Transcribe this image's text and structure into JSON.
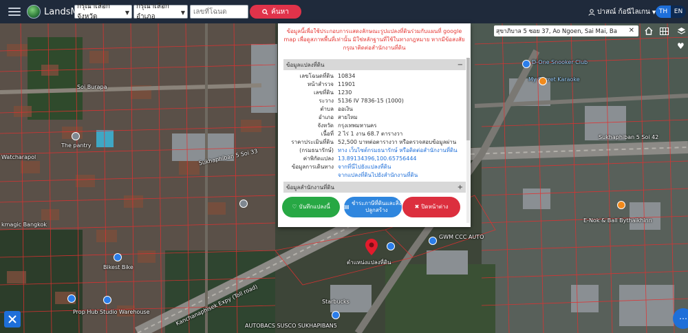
{
  "topbar": {
    "brand": "LandsMaps",
    "province_select": "กรุณาเลือกจังหวัด",
    "district_select": "กรุณาเลือกอำเภอ",
    "plot_placeholder": "เลขที่โฉนด",
    "search_label": "ค้นหา",
    "user_name": "ปาสณ์ ก้อนีไลเกน",
    "lang_th": "TH",
    "lang_en": "EN",
    "colors": {
      "bar": "#1f2a3b",
      "search_button": "#e0334a",
      "lang_active": "#1e6fd9"
    }
  },
  "map": {
    "search_value": "สุขาภิบาล 5 ซอย 37, Ao Ngoen, Sai Mai, Ba",
    "labels": {
      "soi_burapa": "Soi Burapa",
      "the_pantry": "The pantry",
      "watcharapol": "Watcharapol",
      "sukhaphiban5_soi33": "Sukhaphiban 5 Soi 33",
      "kmagic": "kmagic Bangkok",
      "prop_hub": "Prop Hub Studio Warehouse",
      "sukhaphiban5_soi42": "Sukhaphiban 5 Soi 42",
      "d_one": "D-One Snooker Club",
      "myscent": "My Secret Karaoke",
      "gwm": "GWM CCC AUTO",
      "e_nok": "E-Nok & Ball Bythaikhinn",
      "starbucks": "Starbucks",
      "autobacs": "AUTOBACS SUSCO SUKHAPIBAN5",
      "bikest": "Bikest Bike",
      "expy": "Kanchanaphisek Expy (Toll road)",
      "site": "ตำแหน่งแปลงที่ดิน"
    }
  },
  "popup": {
    "notice": "ข้อมูลนี้เพื่อใช้ประกอบการแสดงลักษณะรูปแปลงที่ดินร่วมกับแผนที่ google map เพื่อดูสภาพพื้นที่เท่านั้น มิใช่หลักฐานที่ใช้ในทางกฎหมาย หากมีข้อสงสัย กรุณาติดต่อสำนักงานที่ดิน",
    "section_parcel": "ข้อมูลแปลงที่ดิน",
    "section_office": "ข้อมูลสำนักงานที่ดิน",
    "rows": [
      {
        "k": "เลขโฉนดที่ดิน",
        "v": "10834"
      },
      {
        "k": "หน้าสำรวจ",
        "v": "11901"
      },
      {
        "k": "เลขที่ดิน",
        "v": "1230"
      },
      {
        "k": "ระวาง",
        "v": "5136 IV 7836-15 (1000)"
      },
      {
        "k": "ตำบล",
        "v": "ออเงิน"
      },
      {
        "k": "อำเภอ",
        "v": "สายไหม"
      },
      {
        "k": "จังหวัด",
        "v": "กรุงเทพมหานคร"
      },
      {
        "k": "เนื้อที่",
        "v": "2 ไร่ 1 งาน 68.7 ตารางวา"
      },
      {
        "k": "ราคาประเมินที่ดิน",
        "v": "52,500 บาทต่อตารางวา หรือตรวจสอบข้อมูลผ่าน"
      },
      {
        "k": "(กรมธนารักษ์)",
        "v": "ทาง เว็บไซต์กรมธนารักษ์ หรือติดต่อสำนักงานที่ดิน"
      },
      {
        "k": "ค่าพิกัดแปลง",
        "v": "13.89134396,100.65756444"
      },
      {
        "k": "ข้อมูลการเดินทาง",
        "v": "จากที่นี่ไปยังแปลงที่ดิน"
      },
      {
        "k": "",
        "v": "จากแปลงที่ดินไปยังสำนักงานที่ดิน"
      }
    ],
    "btn_save": "บันทึกแปลงนี้",
    "btn_tax": "ชำระภาษีที่ดินและสิ่งปลูกสร้าง",
    "btn_close": "ปิดหน้าต่าง",
    "colors": {
      "notice": "#e53935",
      "link": "#1e6fd9",
      "save": "#27a844",
      "tax": "#2f86de",
      "close": "#dc2f3e"
    }
  }
}
